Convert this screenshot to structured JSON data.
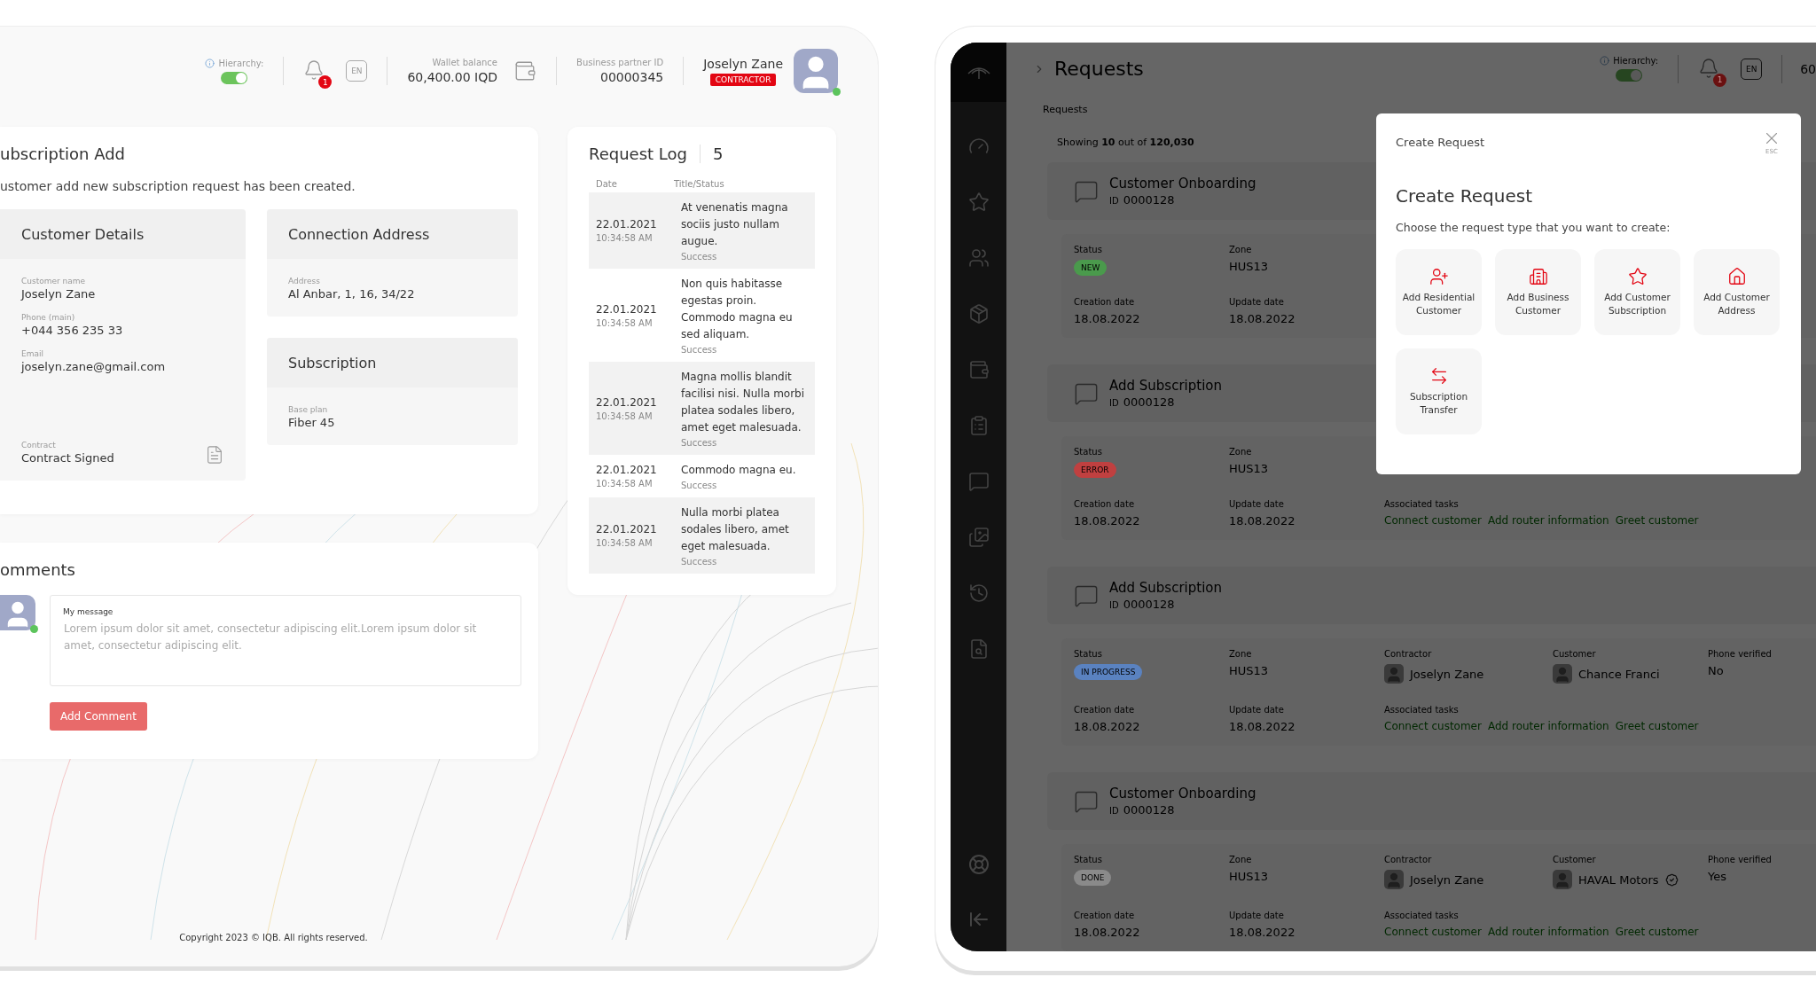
{
  "left_screen": {
    "header": {
      "hierarchy": {
        "label": "Hierarchy:",
        "on": true
      },
      "notifications": {
        "count": "1"
      },
      "language": "EN",
      "wallet": {
        "label": "Wallet balance",
        "value": "60,400.00 IQD"
      },
      "partner": {
        "label": "Business partner ID",
        "value": "00000345"
      },
      "user": {
        "name": "Joselyn Zane",
        "role": "CONTRACTOR",
        "online": true
      }
    },
    "subscription_card": {
      "title": "ubscription Add",
      "message": "ustomer add new subscription request has been created.",
      "customer_details": {
        "title": "Customer Details",
        "fields": [
          {
            "label": "Customer name",
            "value": "Joselyn Zane"
          },
          {
            "label": "Phone (main)",
            "value": "+044 356 235 33"
          },
          {
            "label": "Email",
            "value": "joselyn.zane@gmail.com"
          }
        ],
        "contract": {
          "label": "Contract",
          "value": "Contract Signed"
        }
      },
      "connection_address": {
        "title": "Connection Address",
        "fields": [
          {
            "label": "Address",
            "value": "Al Anbar, 1, 16, 34/22"
          }
        ]
      },
      "subscription": {
        "title": "Subscription",
        "fields": [
          {
            "label": "Base plan",
            "value": "Fiber 45"
          }
        ]
      }
    },
    "comments": {
      "title": "omments",
      "message": {
        "label": "My message",
        "placeholder": "Lorem ipsum dolor sit amet, consectetur adipiscing elit.Lorem ipsum dolor sit amet, consectetur adipiscing elit."
      },
      "button": {
        "label": "Add Comment",
        "disabled": true
      },
      "online": true
    },
    "request_log": {
      "title": "Request Log",
      "count": "5",
      "columns": [
        "Date",
        "Title/Status"
      ],
      "rows": [
        {
          "date": "22.01.2021",
          "time": "10:34:58 AM",
          "title": "At venenatis magna sociis justo nullam augue.",
          "status": "Success"
        },
        {
          "date": "22.01.2021",
          "time": "10:34:58 AM",
          "title": "Non quis habitasse egestas proin. Commodo magna eu sed aliquam.",
          "status": "Success"
        },
        {
          "date": "22.01.2021",
          "time": "10:34:58 AM",
          "title": "Magna mollis blandit facilisi nisi. Nulla morbi platea sodales libero, amet eget malesuada.",
          "status": "Success"
        },
        {
          "date": "22.01.2021",
          "time": "10:34:58 AM",
          "title": "Commodo magna eu.",
          "status": "Success"
        },
        {
          "date": "22.01.2021",
          "time": "10:34:58 AM",
          "title": "Nulla morbi platea sodales libero, amet eget malesuada.",
          "status": "Success"
        }
      ]
    },
    "copyright": "Copyright 2023 © IQB. All rights reserved."
  },
  "right_screen": {
    "header": {
      "title": "Requests",
      "hierarchy": {
        "label": "Hierarchy:",
        "on": true
      },
      "notifications": {
        "count": "1"
      },
      "language": "EN",
      "wallet_value": "60"
    },
    "breadcrumb": "Requests",
    "showing": "Showing **10** out of **120,030**",
    "requests": [
      {
        "title": "Customer Onboarding",
        "id_label": "ID",
        "id": "0000128",
        "top_fields": [
          {
            "kind": "status",
            "label": "Status",
            "value": "NEW",
            "color": "#4a9a4c"
          },
          {
            "kind": "text",
            "label": "Zone",
            "value": "HUS13"
          }
        ],
        "bottom_fields": [
          {
            "kind": "text",
            "label": "Creation date",
            "value": "18.08.2022"
          },
          {
            "kind": "text",
            "label": "Update date",
            "value": "18.08.2022"
          }
        ]
      },
      {
        "title": "Add Subscription",
        "id_label": "ID",
        "id": "0000128",
        "top_fields": [
          {
            "kind": "status",
            "label": "Status",
            "value": "ERROR",
            "color": "#c04040"
          },
          {
            "kind": "text",
            "label": "Zone",
            "value": "HUS13"
          }
        ],
        "bottom_fields": [
          {
            "kind": "text",
            "label": "Creation date",
            "value": "18.08.2022"
          },
          {
            "kind": "text",
            "label": "Update date",
            "value": "18.08.2022"
          },
          {
            "kind": "tasks",
            "label": "Associated tasks",
            "tasks": [
              "Connect customer",
              "Add router information",
              "Greet customer"
            ]
          }
        ]
      },
      {
        "title": "Add Subscription",
        "id_label": "ID",
        "id": "0000128",
        "top_fields": [
          {
            "kind": "status",
            "label": "Status",
            "value": "IN PROGRESS",
            "color": "#5a82c0"
          },
          {
            "kind": "text",
            "label": "Zone",
            "value": "HUS13"
          },
          {
            "kind": "person",
            "label": "Contractor",
            "value": "Joselyn Zane",
            "business": false
          },
          {
            "kind": "person",
            "label": "Customer",
            "value": "Chance Franci",
            "business": false
          },
          {
            "kind": "text",
            "label": "Phone verified",
            "value": "No"
          }
        ],
        "bottom_fields": [
          {
            "kind": "text",
            "label": "Creation date",
            "value": "18.08.2022"
          },
          {
            "kind": "text",
            "label": "Update date",
            "value": "18.08.2022"
          },
          {
            "kind": "tasks",
            "label": "Associated tasks",
            "tasks": [
              "Connect customer",
              "Add router information",
              "Greet customer"
            ]
          }
        ]
      },
      {
        "title": "Customer Onboarding",
        "id_label": "ID",
        "id": "0000128",
        "top_fields": [
          {
            "kind": "status",
            "label": "Status",
            "value": "DONE",
            "color": "#8a8a8a"
          },
          {
            "kind": "text",
            "label": "Zone",
            "value": "HUS13"
          },
          {
            "kind": "person",
            "label": "Contractor",
            "value": "Joselyn Zane",
            "business": false
          },
          {
            "kind": "person",
            "label": "Customer",
            "value": "HAVAL Motors",
            "business": true
          },
          {
            "kind": "text",
            "label": "Phone verified",
            "value": "Yes"
          }
        ],
        "bottom_fields": [
          {
            "kind": "text",
            "label": "Creation date",
            "value": "18.08.2022"
          },
          {
            "kind": "text",
            "label": "Update date",
            "value": "18.08.2022"
          },
          {
            "kind": "tasks",
            "label": "Associated tasks",
            "tasks": [
              "Connect customer",
              "Add router information",
              "Greet customer"
            ]
          }
        ]
      }
    ],
    "modal": {
      "header": "Create Request",
      "close_hint": "ESC",
      "title": "Create Request",
      "subtitle": "Choose the request type that you want to create:",
      "options": [
        {
          "kind": "residential",
          "label": "Add Residential Customer"
        },
        {
          "kind": "business",
          "label": "Add Business Customer"
        },
        {
          "kind": "subscription",
          "label": "Add Customer Subscription"
        },
        {
          "kind": "address",
          "label": "Add Customer Address"
        },
        {
          "kind": "transfer",
          "label": "Subscription Transfer"
        }
      ]
    }
  }
}
